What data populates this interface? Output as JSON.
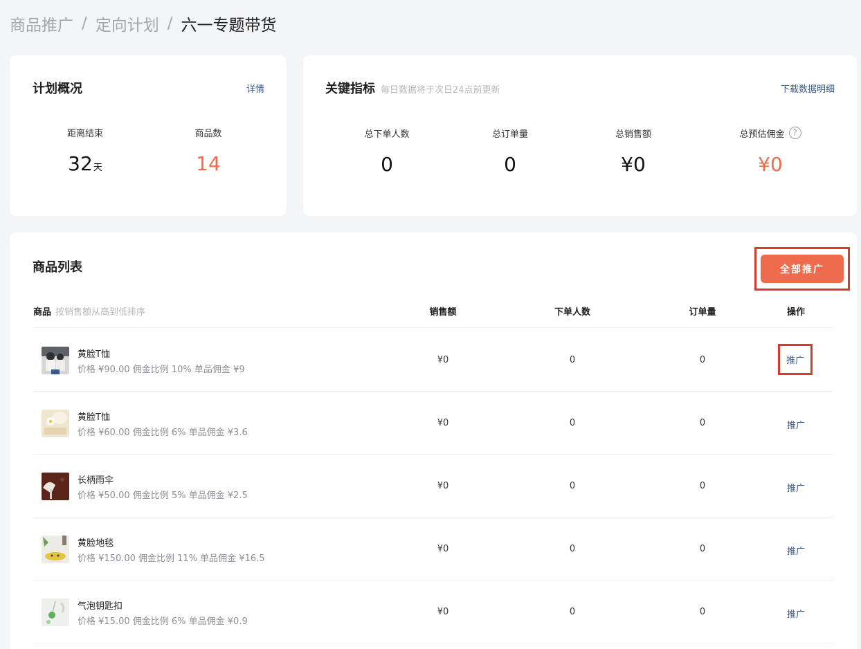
{
  "breadcrumb": {
    "level1": "商品推广",
    "level2": "定向计划",
    "current": "六一专题带货",
    "separator": "/"
  },
  "overview": {
    "title": "计划概况",
    "detail_link": "详情",
    "stats": [
      {
        "label": "距离结束",
        "value": "32",
        "unit": "天"
      },
      {
        "label": "商品数",
        "value": "14"
      }
    ]
  },
  "metrics": {
    "title": "关键指标",
    "subtitle": "每日数据将于次日24点前更新",
    "download_link": "下载数据明细",
    "stats": [
      {
        "label": "总下单人数",
        "value": "0"
      },
      {
        "label": "总订单量",
        "value": "0"
      },
      {
        "label": "总销售额",
        "value": "¥0"
      },
      {
        "label": "总预估佣金",
        "value": "¥0"
      }
    ],
    "help_glyph": "?"
  },
  "product_list": {
    "title": "商品列表",
    "promote_all_button": "全部推广",
    "columns": {
      "product": "商品",
      "product_hint": "按销售额从高到低排序",
      "sales": "销售额",
      "buyers": "下单人数",
      "orders": "订单量",
      "action": "操作"
    },
    "rows": [
      {
        "name": "黄脸T恤",
        "meta": "价格 ¥90.00 佣金比例 10% 单品佣金 ¥9",
        "sales": "¥0",
        "buyers": "0",
        "orders": "0",
        "action": "推广",
        "thumb_icon": "tshirt-photo",
        "colors": [
          "#d8d6d2",
          "#3a3b3f"
        ]
      },
      {
        "name": "黄脸T恤",
        "meta": "价格 ¥60.00 佣金比例 6% 单品佣金 ¥3.6",
        "sales": "¥0",
        "buyers": "0",
        "orders": "0",
        "action": "推广",
        "thumb_icon": "tshirt-photo",
        "colors": [
          "#e9dcbf",
          "#f5f1e6"
        ]
      },
      {
        "name": "长柄雨伞",
        "meta": "价格 ¥50.00 佣金比例 5% 单品佣金 ¥2.5",
        "sales": "¥0",
        "buyers": "0",
        "orders": "0",
        "action": "推广",
        "thumb_icon": "umbrella-photo",
        "colors": [
          "#5a2418",
          "#e8e2da"
        ]
      },
      {
        "name": "黄脸地毯",
        "meta": "价格 ¥150.00 佣金比例 11% 单品佣金 ¥16.5",
        "sales": "¥0",
        "buyers": "0",
        "orders": "0",
        "action": "推广",
        "thumb_icon": "rug-photo",
        "colors": [
          "#e9e6df",
          "#e3c43a"
        ]
      },
      {
        "name": "气泡钥匙扣",
        "meta": "价格 ¥15.00 佣金比例 6% 单品佣金 ¥0.9",
        "sales": "¥0",
        "buyers": "0",
        "orders": "0",
        "action": "推广",
        "thumb_icon": "keychain-photo",
        "colors": [
          "#eef0ee",
          "#5fae5a"
        ]
      }
    ]
  }
}
